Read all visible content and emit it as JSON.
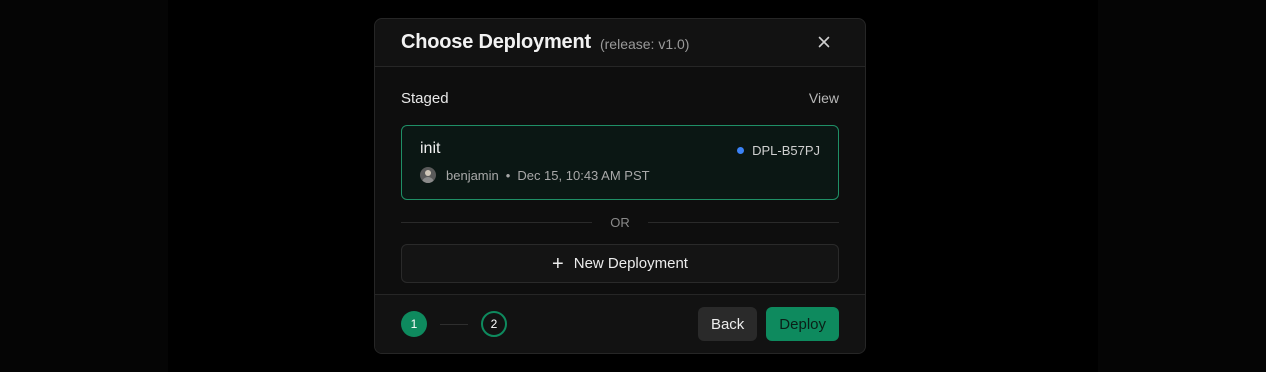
{
  "modal": {
    "title": "Choose Deployment",
    "subtitle": "(release: v1.0)",
    "close_icon": "close-icon"
  },
  "staged": {
    "section_title": "Staged",
    "view_label": "View",
    "card": {
      "name": "init",
      "id": "DPL-B57PJ",
      "status_color": "#3b82f6",
      "author": "benjamin",
      "separator": "•",
      "timestamp": "Dec 15, 10:43 AM PST"
    }
  },
  "divider": {
    "text": "OR"
  },
  "new_deployment": {
    "icon": "plus-icon",
    "label": "New Deployment"
  },
  "footer": {
    "steps": [
      {
        "number": "1",
        "state": "active"
      },
      {
        "number": "2",
        "state": "upcoming"
      }
    ],
    "back_label": "Back",
    "deploy_label": "Deploy"
  },
  "colors": {
    "accent": "#0e8a5e",
    "card_border": "#1f8f66",
    "background": "#000000"
  }
}
